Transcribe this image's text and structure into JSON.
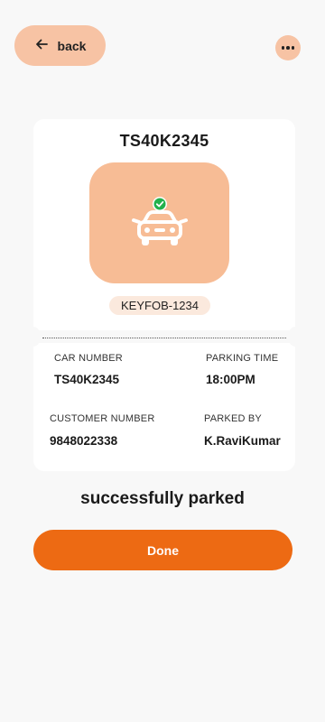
{
  "header": {
    "back_label": "back"
  },
  "ticket": {
    "plate": "TS40K2345",
    "keyfob": "KEYFOB-1234",
    "car_number_label": "CAR NUMBER",
    "car_number": "TS40K2345",
    "parking_time_label": "PARKING TIME",
    "parking_time": "18:00PM",
    "customer_number_label": "CUSTOMER NUMBER",
    "customer_number": "9848022338",
    "parked_by_label": "PARKED BY",
    "parked_by": "K.RaviKumar"
  },
  "status_text": "successfully parked",
  "done_label": "Done",
  "colors": {
    "accent": "#ED6A13",
    "peach": "#F7C3A4",
    "car_bg": "#F7BC95",
    "check": "#22B14C"
  }
}
